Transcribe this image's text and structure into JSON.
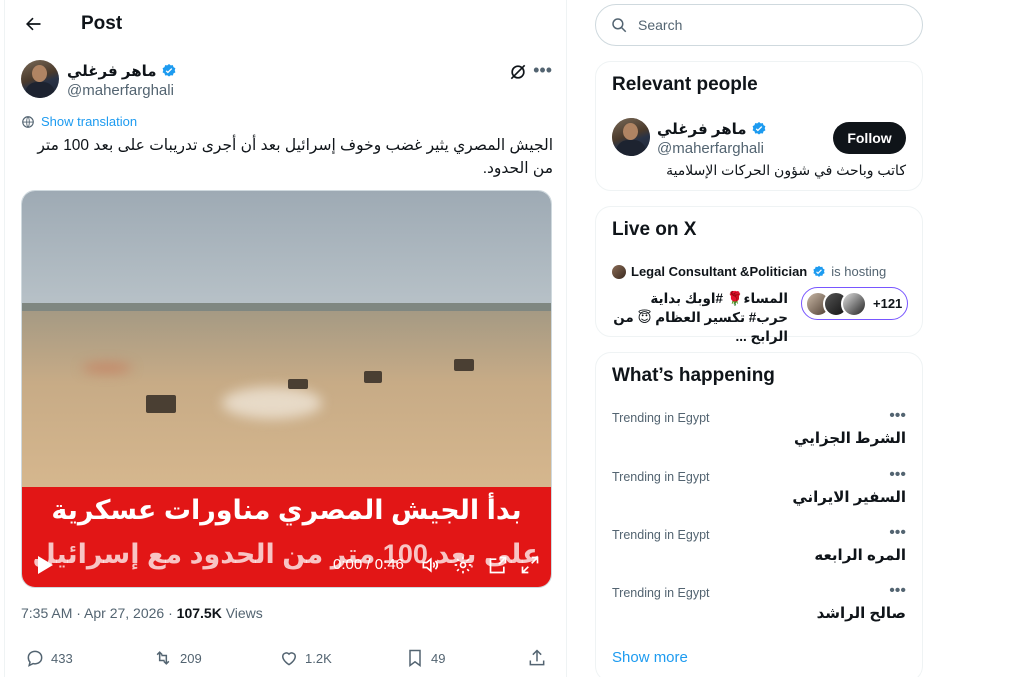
{
  "header": {
    "title": "Post",
    "back_icon": "arrow-left-icon"
  },
  "post": {
    "author_name": "ماهر فرغلي",
    "author_handle": "@maherfarghali",
    "verified": true,
    "show_translation": "Show translation",
    "text": "الجيش المصري يثير غضب وخوف إسرائيل بعد أن أجرى تدريبات على بعد 100 متر من الحدود.",
    "video": {
      "caption_line1": "بدأ الجيش المصري مناورات عسكرية",
      "caption_line2": "على بعد 100 متر من الحدود مع إسرائيل",
      "time": "0:00 / 0:46"
    },
    "timestamp": "7:35 AM · Apr 27, 2026 · ",
    "views_count": "107.5K",
    "views_label": " Views",
    "actions": {
      "replies": "433",
      "reposts": "209",
      "likes": "1.2K",
      "bookmarks": "49"
    }
  },
  "search": {
    "placeholder": "Search"
  },
  "relevant_people": {
    "title": "Relevant people",
    "name": "ماهر فرغلي",
    "handle": "@maherfarghali",
    "bio": "كاتب وباحث في شؤون الحركات الإسلامية",
    "follow_label": "Follow"
  },
  "live": {
    "title": "Live on X",
    "host_name": "Legal Consultant &Politician",
    "hosting_label": "is hosting",
    "space_title": "المساء🌹 #اوبك بداية حرب# تكسير العظام 😇 من الرابح ...",
    "listener_count": "+121"
  },
  "trends": {
    "title": "What’s happening",
    "items": [
      {
        "context": "Trending in Egypt",
        "name": "الشرط الجزايي"
      },
      {
        "context": "Trending in Egypt",
        "name": "السفير الايراني"
      },
      {
        "context": "Trending in Egypt",
        "name": "المره الرابعه"
      },
      {
        "context": "Trending in Egypt",
        "name": "صالح الراشد"
      }
    ],
    "show_more": "Show more"
  },
  "colors": {
    "accent": "#1d9bf0",
    "verified": "#1d9bf0",
    "banner_red": "#e21616",
    "live_border": "#7856ff"
  }
}
